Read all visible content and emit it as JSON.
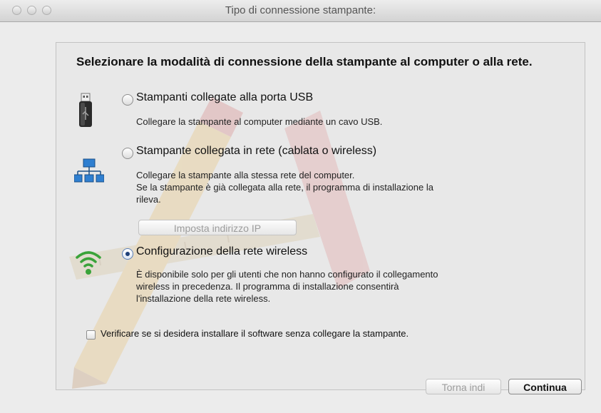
{
  "window": {
    "title": "Tipo di connessione stampante:"
  },
  "dialog": {
    "heading": "Selezionare la modalità di connessione della stampante al computer o alla rete.",
    "options": [
      {
        "label": "Stampanti collegate alla porta USB",
        "description": "Collegare la stampante al computer mediante un cavo USB.",
        "selected": false,
        "icon": "usb-icon"
      },
      {
        "label": "Stampante collegata in rete (cablata o wireless)",
        "description_lines": [
          "Collegare la stampante alla stessa rete del computer.",
          "Se la stampante è già collegata alla rete, il programma di installazione la",
          "rileva."
        ],
        "selected": false,
        "icon": "network-icon",
        "button_label": "Imposta indirizzo IP"
      },
      {
        "label": "Configurazione della rete wireless",
        "description_lines": [
          "È disponibile solo per gli utenti che non hanno configurato il collegamento",
          "wireless in precedenza. Il programma di installazione consentirà",
          "l'installazione della rete wireless."
        ],
        "selected": true,
        "icon": "wifi-icon"
      }
    ],
    "checkbox": {
      "label": "Verificare se si desidera installare il software senza collegare la stampante.",
      "checked": false
    }
  },
  "footer": {
    "back_label": "Torna indi",
    "continue_label": "Continua"
  }
}
